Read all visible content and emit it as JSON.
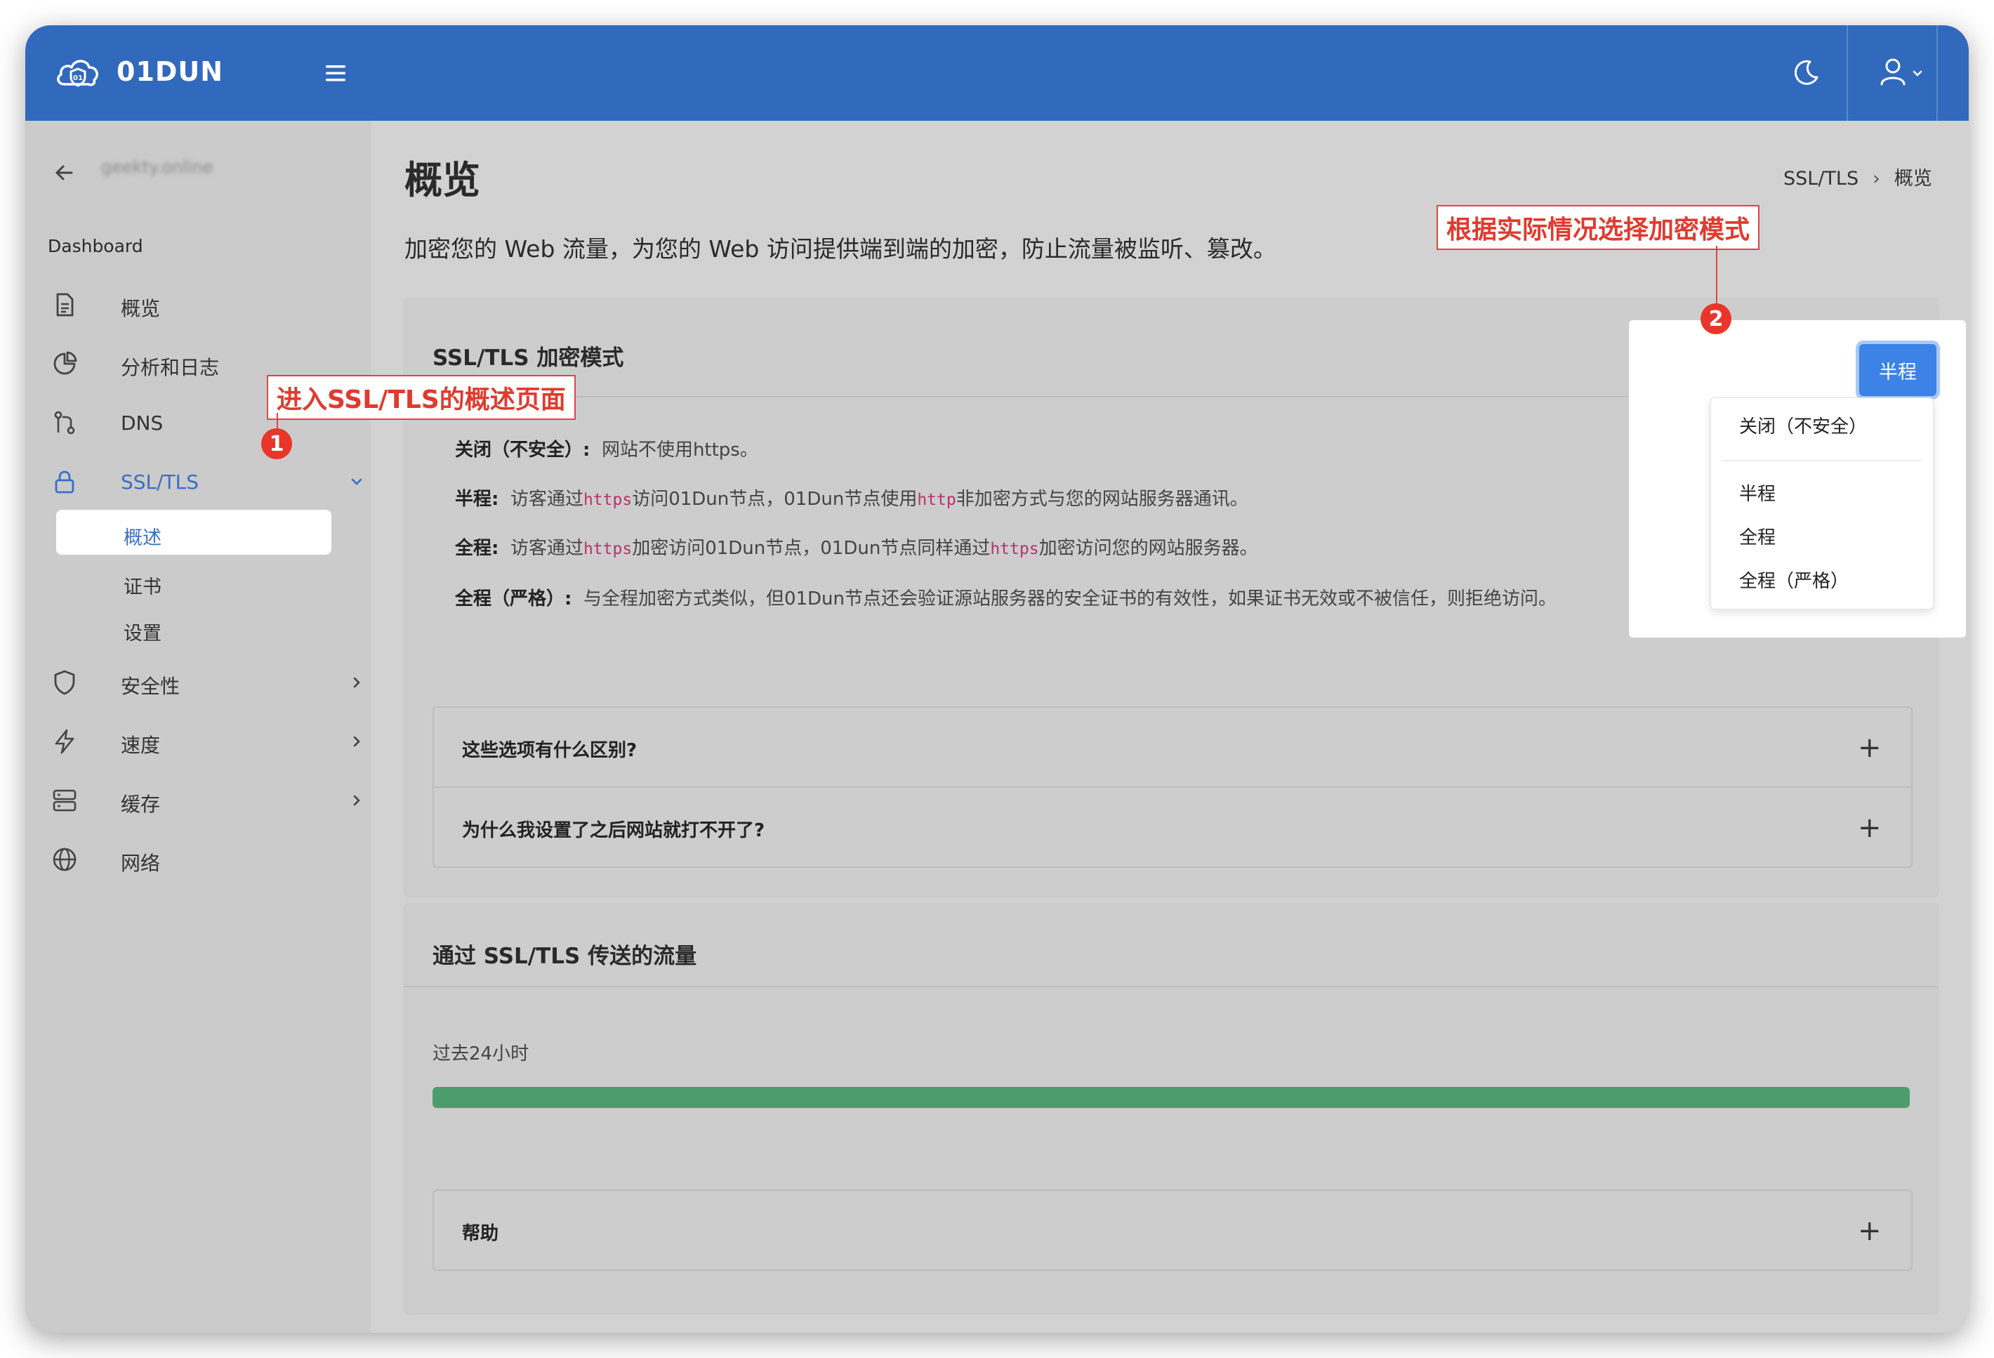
{
  "header": {
    "brand": "01DUN"
  },
  "sidebar": {
    "site_name": "geekty.online",
    "section": "Dashboard",
    "items": [
      {
        "label": "概览"
      },
      {
        "label": "分析和日志"
      },
      {
        "label": "DNS"
      },
      {
        "label": "SSL/TLS"
      },
      {
        "label": "安全性"
      },
      {
        "label": "速度"
      },
      {
        "label": "缓存"
      },
      {
        "label": "网络"
      }
    ],
    "ssl_subitems": [
      {
        "label": "概述"
      },
      {
        "label": "证书"
      },
      {
        "label": "设置"
      }
    ]
  },
  "main": {
    "title": "概览",
    "breadcrumb": [
      "SSL/TLS",
      "概览"
    ],
    "description": "加密您的 Web 流量，为您的 Web 访问提供端到端的加密，防止流量被监听、篡改。",
    "encryption_card": {
      "title": "SSL/TLS 加密模式",
      "modes": [
        {
          "name": "关闭（不安全）:",
          "parts": [
            "网站不使用https。"
          ]
        },
        {
          "name": "半程:",
          "parts": [
            "访客通过",
            "https",
            "访问01Dun节点，01Dun节点使用",
            "http",
            "非加密方式与您的网站服务器通讯。"
          ]
        },
        {
          "name": "全程:",
          "parts": [
            "访客通过",
            "https",
            "加密访问01Dun节点，01Dun节点同样通过",
            "https",
            "加密访问您的网站服务器。"
          ]
        },
        {
          "name": "全程（严格）:",
          "parts": [
            "与全程加密方式类似，但01Dun节点还会验证源站服务器的安全证书的有效性，如果证书无效或不被信任，则拒绝访问。"
          ]
        }
      ],
      "faq": [
        "这些选项有什么区别?",
        "为什么我设置了之后网站就打不开了?"
      ]
    },
    "traffic_card": {
      "title": "通过 SSL/TLS 传送的流量",
      "period_label": "过去24小时",
      "progress": 1.0,
      "help": "帮助"
    }
  },
  "mode_select": {
    "current": "半程",
    "options": [
      "关闭（不安全）",
      "半程",
      "全程",
      "全程（严格）"
    ]
  },
  "annotations": {
    "step1_text": "进入SSL/TLS的概述页面",
    "step1_num": "1",
    "step2_text": "根据实际情况选择加密模式",
    "step2_num": "2",
    "color": "#e0463b"
  },
  "colors": {
    "brand": "#3169bd",
    "accent": "#3d82e6",
    "progress": "#4d9c6e",
    "code": "#b8336a"
  }
}
